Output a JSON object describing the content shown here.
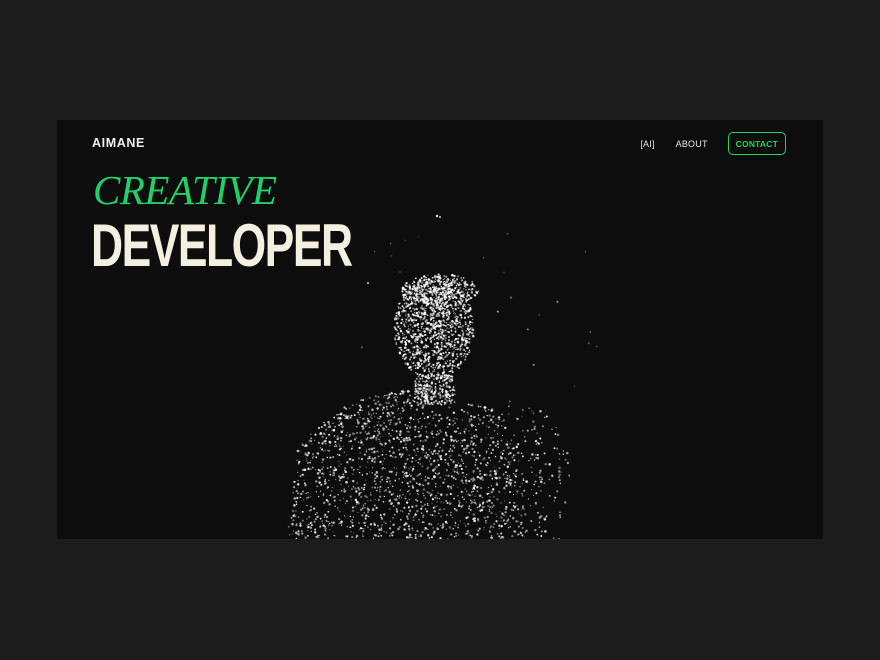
{
  "header": {
    "logo": "AIMANE",
    "nav": {
      "ai_label": "[AI]",
      "about_label": "ABOUT",
      "contact_label": "CONTACT"
    }
  },
  "hero": {
    "line1": "CREATIVE",
    "line2": "DEVELOPER"
  },
  "colors": {
    "page_background": "#1c1c1c",
    "frame_background": "#0d0d0d",
    "accent": "#1fd16a",
    "headline_cream": "#f4f0e0",
    "particles": "#ffffff"
  },
  "icons": {
    "portrait": "particle-portrait"
  }
}
